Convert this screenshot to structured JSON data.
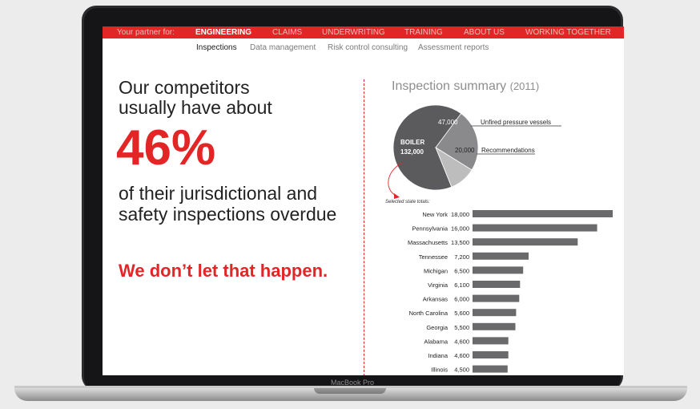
{
  "device": {
    "bezel_label": "MacBook Pro"
  },
  "topnav": {
    "prefix": "Your partner for:",
    "items": [
      "ENGINEERING",
      "CLAIMS",
      "UNDERWRITING",
      "TRAINING",
      "ABOUT US",
      "WORKING TOGETHER"
    ],
    "active": "ENGINEERING"
  },
  "subnav": {
    "items": [
      "Inspections",
      "Data management",
      "Risk control consulting",
      "Assessment reports"
    ],
    "active": "Inspections"
  },
  "hero": {
    "line1": "Our competitors",
    "line2": "usually have about",
    "big_number": "46%",
    "line3": "of their jurisdictional and",
    "line4": "safety inspections overdue",
    "tagline": "We don’t let that happen."
  },
  "summary": {
    "title": "Inspection summary",
    "year": "(2011)"
  },
  "chart_data": [
    {
      "type": "pie",
      "labels": [
        "BOILER",
        "Unfired pressure vessels",
        "Recommendations"
      ],
      "values": [
        132000,
        47000,
        20000
      ],
      "value_labels": [
        "132,000",
        "47,000",
        "20,000"
      ],
      "colors": [
        "#5b5b5d",
        "#8a8a8c",
        "#bdbdbd"
      ]
    },
    {
      "type": "bar",
      "orientation": "horizontal",
      "title": "Selected state totals:",
      "categories": [
        "New York",
        "Pennsylvania",
        "Massachusetts",
        "Tennessee",
        "Michigan",
        "Virginia",
        "Arkansas",
        "North Carolina",
        "Georgia",
        "Alabama",
        "Indiana",
        "Illinois"
      ],
      "values": [
        18000,
        16000,
        13500,
        7200,
        6500,
        6100,
        6000,
        5600,
        5500,
        4600,
        4600,
        4500
      ],
      "value_labels": [
        "18,000",
        "16,000",
        "13,500",
        "7,200",
        "6,500",
        "6,100",
        "6,000",
        "5,600",
        "5,500",
        "4,600",
        "4,600",
        "4,500"
      ],
      "bar_color": "#6a6a6c"
    }
  ],
  "colors": {
    "accent": "#e32526",
    "text": "#222222",
    "muted": "#8e8e8e"
  }
}
